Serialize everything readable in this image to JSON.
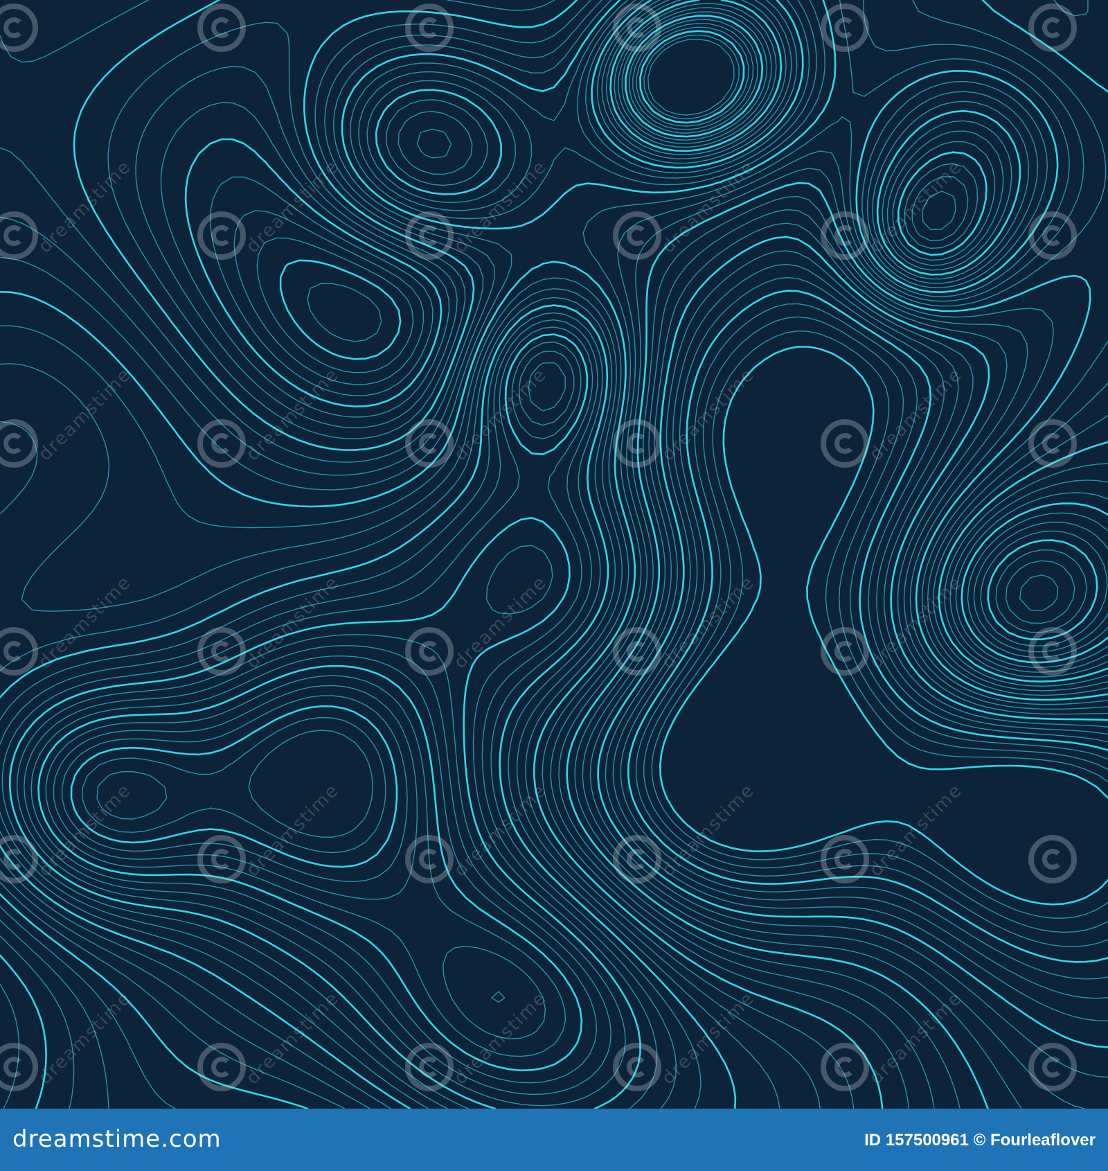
{
  "image": {
    "background": "#0d2339",
    "line_color_bright": "#31d6e6",
    "line_color_dim": "#2ba7bf"
  },
  "watermark": {
    "text": "dreamstime",
    "icon": "spiral-icon"
  },
  "footer": {
    "background": "#1f73b7",
    "brand": "dreamstime.com",
    "id_line": "ID 157500961 © Fourleaflover"
  }
}
